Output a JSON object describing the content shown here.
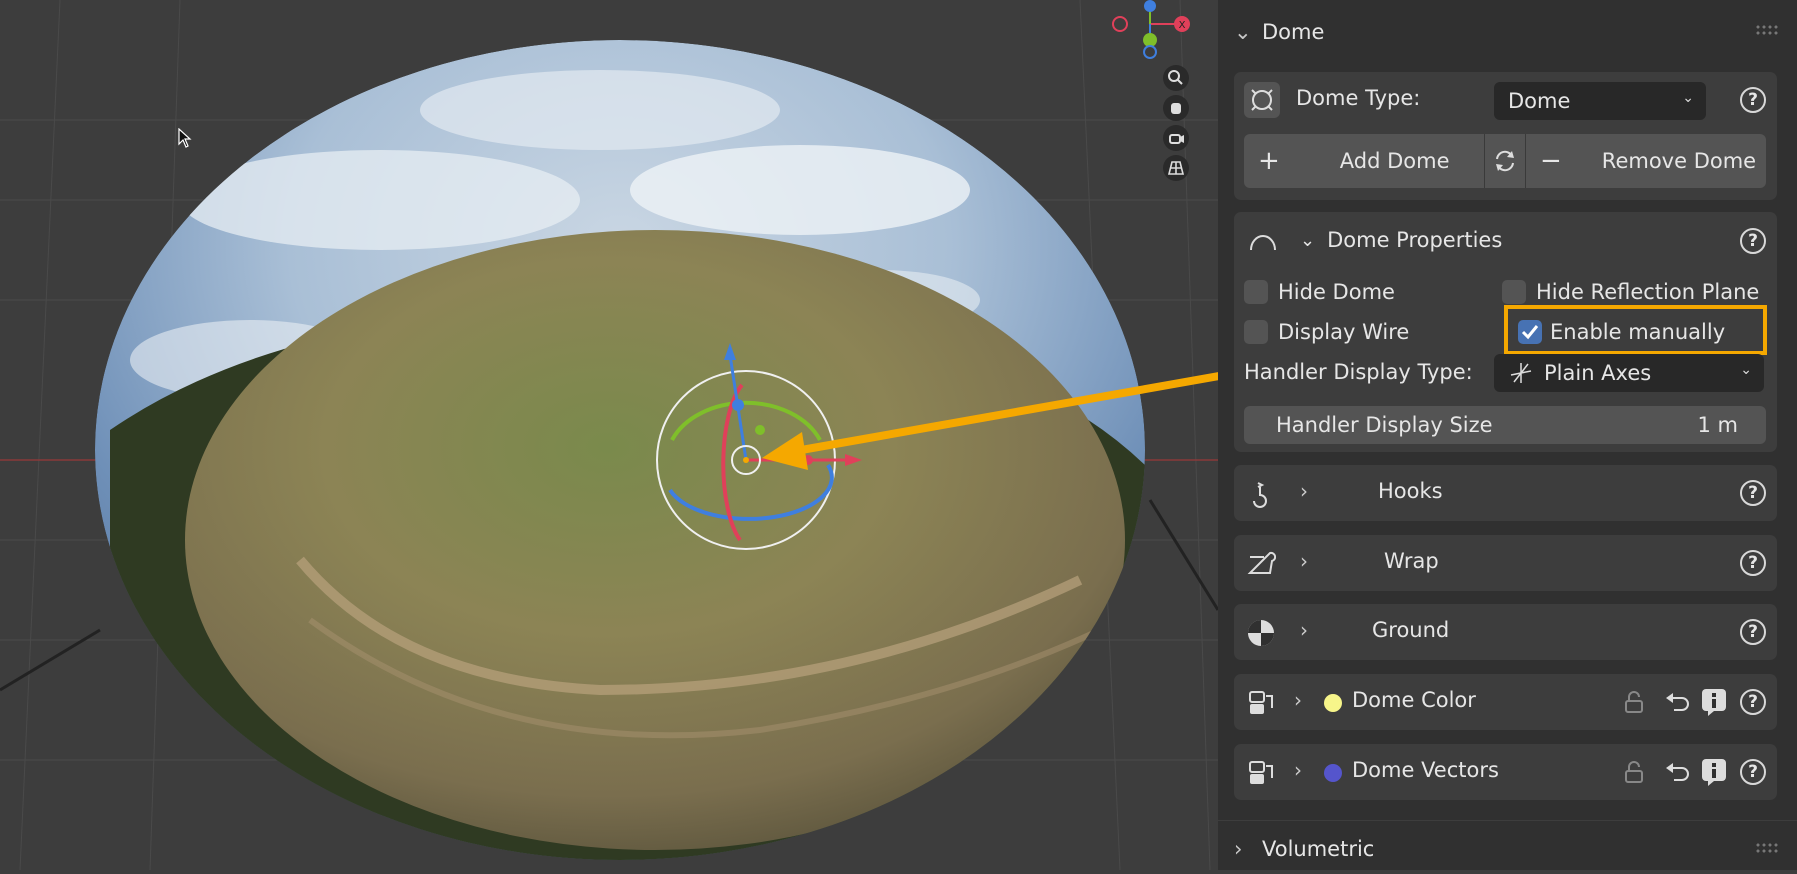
{
  "viewport": {
    "tools": [
      "zoom-icon",
      "hand-pan-icon",
      "camera-icon",
      "grid-perspective-icon"
    ],
    "gizmo_axes": [
      "X",
      "Y",
      "Z"
    ]
  },
  "panel": {
    "title": "Dome",
    "dome_type_label": "Dome Type:",
    "dome_type_value": "Dome",
    "add_dome": "Add Dome",
    "remove_dome": "Remove Dome",
    "properties_title": "Dome Properties",
    "hide_dome": "Hide Dome",
    "hide_reflection_plane": "Hide Reflection Plane",
    "display_wire": "Display Wire",
    "enable_manually": "Enable manually",
    "enable_manually_checked": true,
    "handler_display_type_label": "Handler Display Type:",
    "handler_display_type_value": "Plain Axes",
    "handler_display_size_label": "Handler Display Size",
    "handler_display_size_value": "1 m",
    "subpanels": [
      {
        "name": "Hooks"
      },
      {
        "name": "Wrap"
      },
      {
        "name": "Ground"
      },
      {
        "name": "Dome Color",
        "dot_color": "#f7f58a"
      },
      {
        "name": "Dome Vectors",
        "dot_color": "#5555cc"
      }
    ],
    "volumetric": "Volumetric"
  },
  "colors": {
    "highlight": "#f5a800",
    "checkbox_on": "#4772b3",
    "axis_x": "#e0405a",
    "axis_y": "#7fbf2a",
    "axis_z": "#3f7fdf"
  }
}
